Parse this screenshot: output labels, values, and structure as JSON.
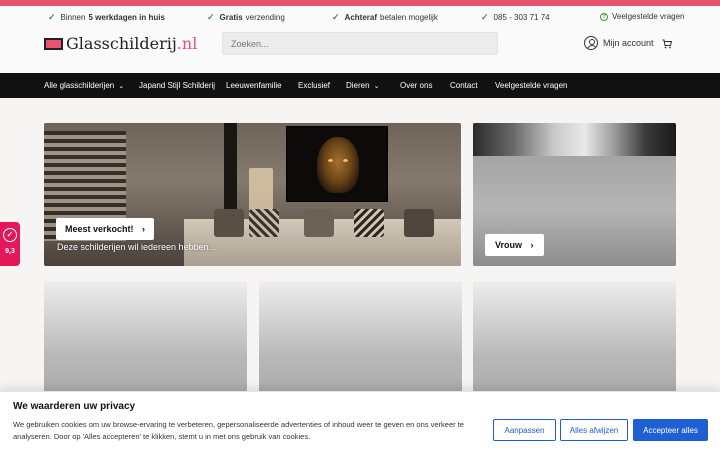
{
  "usp_bar": {
    "items": [
      {
        "pre": "Binnen",
        "bold": "5 werkdagen in huis",
        "post": ""
      },
      {
        "pre": "",
        "bold": "Gratis",
        "post": "verzending"
      },
      {
        "pre": "",
        "bold": "Achteraf",
        "post": "betalen mogelijk"
      },
      {
        "pre": "",
        "bold": "",
        "post": "085 - 303 71 74"
      }
    ],
    "faq_label": "Veelgestelde vragen"
  },
  "header": {
    "logo_name": "Glasschilderij",
    "logo_tld": ".nl",
    "search_placeholder": "Zoeken...",
    "account_label": "Mijn account"
  },
  "nav": {
    "items": [
      "Alle glasschilderijen",
      "Japand Stijl Schilderij",
      "Leeuwenfamilie",
      "Exclusief",
      "Dieren",
      "Over ons",
      "Contact",
      "Veelgestelde vragen"
    ]
  },
  "hero": {
    "button_label": "Meest verkocht!",
    "subtitle": "Deze schilderijen wil iedereen hebben..."
  },
  "tiles": {
    "vrouw_label": "Vrouw"
  },
  "review_badge": {
    "score": "9,3"
  },
  "cookie": {
    "title": "We waarderen uw privacy",
    "text": "We gebruiken cookies om uw browse-ervaring te verbeteren, gepersonaliseerde advertenties of inhoud weer te geven en ons verkeer te analyseren. Door op 'Alles accepteren' te klikken, stemt u in met ons gebruik van cookies.",
    "customize_label": "Aanpassen",
    "reject_label": "Alles afwijzen",
    "accept_label": "Accepteer alles"
  },
  "colors": {
    "accent": "#e8546f",
    "cookie_primary": "#1f5fd4",
    "badge": "#e2185a",
    "nav_bg": "#111111"
  },
  "icons": [
    "check-icon",
    "question-circle-icon",
    "user-icon",
    "cart-icon",
    "chevron-down-icon",
    "chevron-right-icon"
  ]
}
